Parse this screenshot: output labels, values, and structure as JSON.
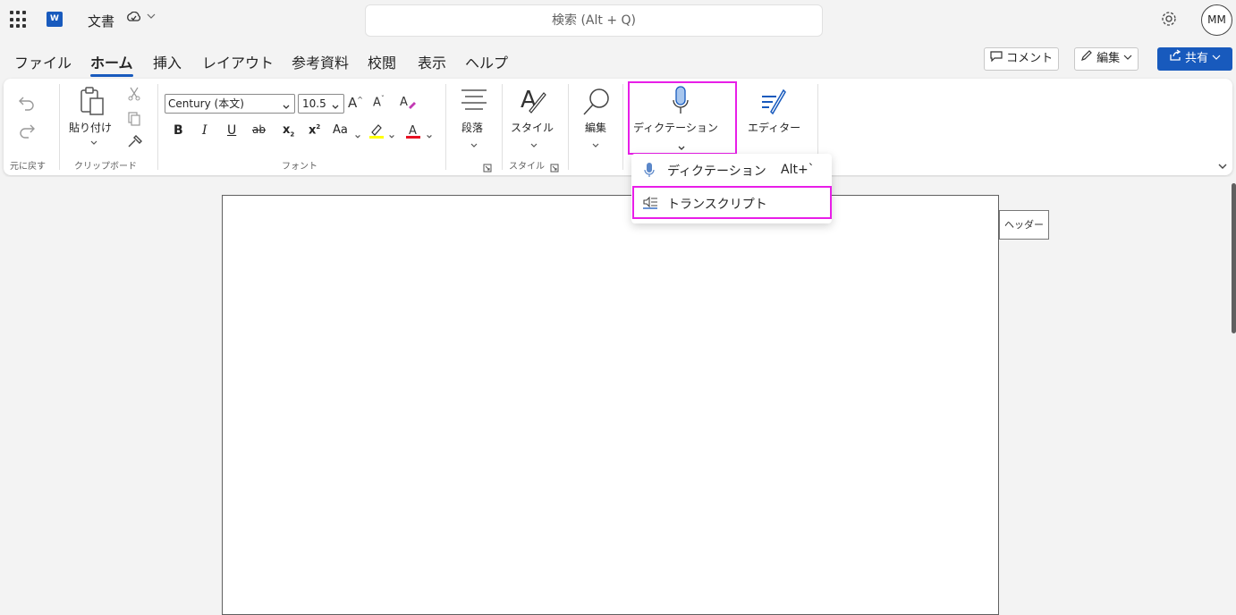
{
  "titlebar": {
    "app_icon_text": "W",
    "doc_title": "文書",
    "search_placeholder": "検索 (Alt + Q)",
    "avatar_initials": "MM"
  },
  "tabs": [
    "ファイル",
    "ホーム",
    "挿入",
    "レイアウト",
    "参考資料",
    "校閲",
    "表示",
    "ヘルプ"
  ],
  "active_tab": "ホーム",
  "header_buttons": {
    "comment": "コメント",
    "edit": "編集",
    "share": "共有"
  },
  "ribbon": {
    "undo_group_label": "元に戻す",
    "paste_label": "貼り付け",
    "clipboard_group_label": "クリップボード",
    "font_name": "Century (本文)",
    "font_size": "10.5",
    "font_group_label": "フォント",
    "paragraph_label": "段落",
    "style_label": "スタイル",
    "style_group_label": "スタイル",
    "edit_label": "編集",
    "dictation_label": "ディクテーション",
    "editor_label": "エディター"
  },
  "dropdown": {
    "items": [
      {
        "label": "ディクテーション",
        "shortcut": "Alt+`",
        "icon": "microphone-icon"
      },
      {
        "label": "トランスクリプト",
        "shortcut": "",
        "icon": "transcript-icon"
      }
    ]
  },
  "document": {
    "header_tag": "ヘッダー"
  },
  "colors": {
    "accent": "#185abd",
    "highlight_box": "#e81ee8",
    "highlighter": "#ffff00",
    "font_color": "#e81123"
  }
}
